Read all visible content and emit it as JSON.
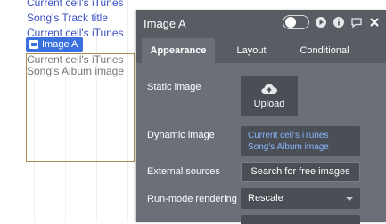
{
  "canvas": {
    "line1": "Current cell's iTunes",
    "line2": "Song's Track title",
    "line3": "Current cell's iTunes",
    "badge": "Image A",
    "image_text_line1": "Current cell's iTunes",
    "image_text_line2": "Song's Album image"
  },
  "panel": {
    "title": "Image A",
    "tabs": [
      "Appearance",
      "Layout",
      "Conditional"
    ],
    "static_image_label": "Static image",
    "upload_label": "Upload",
    "dynamic_image_label": "Dynamic image",
    "dynamic_image_value_line1": "Current cell's iTunes",
    "dynamic_image_value_line2": "Song's Album image",
    "external_sources_label": "External sources",
    "search_images_label": "Search for free images",
    "run_mode_label": "Run-mode rendering",
    "run_mode_value": "Rescale"
  },
  "colors": {
    "panel_bg": "#585c63",
    "tab_body_bg": "#6b7078",
    "link_blue": "#3a4fc0",
    "badge_blue": "#3a70e0"
  },
  "icons": [
    "upload-cloud-icon",
    "play-icon",
    "info-icon",
    "comment-icon",
    "close-icon",
    "image-icon"
  ]
}
